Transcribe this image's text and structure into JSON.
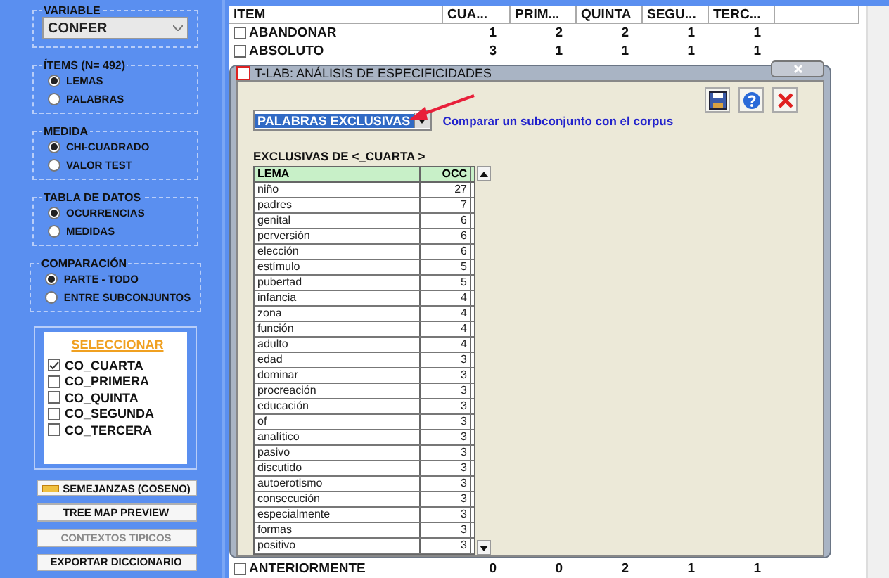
{
  "sidebar": {
    "variable": {
      "label": "VARIABLE",
      "value": "CONFER"
    },
    "groups": [
      {
        "title": "ÍTEMS (N= 492)",
        "options": [
          {
            "label": "LEMAS",
            "selected": true
          },
          {
            "label": "PALABRAS",
            "selected": false
          }
        ]
      },
      {
        "title": "MEDIDA",
        "options": [
          {
            "label": "CHI-CUADRADO",
            "selected": true
          },
          {
            "label": "VALOR TEST",
            "selected": false
          }
        ]
      },
      {
        "title": "TABLA DE DATOS",
        "options": [
          {
            "label": "OCURRENCIAS",
            "selected": true
          },
          {
            "label": "MEDIDAS",
            "selected": false
          }
        ]
      },
      {
        "title": "COMPARACIÓN",
        "options": [
          {
            "label": "PARTE - TODO",
            "selected": true
          },
          {
            "label": "ENTRE SUBCONJUNTOS",
            "selected": false
          }
        ]
      }
    ],
    "select_list": {
      "title": "SELECCIONAR",
      "items": [
        {
          "label": "CO_CUARTA",
          "checked": true
        },
        {
          "label": "CO_PRIMERA",
          "checked": false
        },
        {
          "label": "CO_QUINTA",
          "checked": false
        },
        {
          "label": "CO_SEGUNDA",
          "checked": false
        },
        {
          "label": "CO_TERCERA",
          "checked": false
        }
      ]
    },
    "buttons": [
      {
        "label": "SEMEJANZAS (COSENO)",
        "disabled": false,
        "kind": "icon"
      },
      {
        "label": "TREE MAP PREVIEW",
        "disabled": false,
        "kind": "plain"
      },
      {
        "label": "CONTEXTOS TIPICOS",
        "disabled": true,
        "kind": "plain"
      },
      {
        "label": "EXPORTAR DICCIONARIO",
        "disabled": false,
        "kind": "plain"
      }
    ]
  },
  "table": {
    "columns": [
      "ITEM",
      "CUA...",
      "PRIM...",
      "QUINTA",
      "SEGU...",
      "TERC..."
    ],
    "rows": [
      {
        "item": "ABANDONAR",
        "checked": false,
        "values": [
          "1",
          "2",
          "2",
          "1",
          "1"
        ]
      },
      {
        "item": "ABSOLUTO",
        "checked": false,
        "values": [
          "3",
          "1",
          "1",
          "1",
          "1"
        ]
      },
      {
        "item": "ANTERIORMENTE",
        "checked": false,
        "values": [
          "0",
          "0",
          "2",
          "1",
          "1"
        ]
      }
    ]
  },
  "dialog": {
    "title": "T-LAB: ANÁLISIS DE ESPECIFICIDADES",
    "mode": "PALABRAS EXCLUSIVAS",
    "description": "Comparar un subconjunto con el corpus",
    "subtitle": "EXCLUSIVAS DE <_CUARTA >",
    "columns": [
      "LEMA",
      "OCC"
    ],
    "rows": [
      {
        "lema": "niño",
        "occ": "27"
      },
      {
        "lema": "padres",
        "occ": "7"
      },
      {
        "lema": "genital",
        "occ": "6"
      },
      {
        "lema": "perversión",
        "occ": "6"
      },
      {
        "lema": "elección",
        "occ": "6"
      },
      {
        "lema": "estímulo",
        "occ": "5"
      },
      {
        "lema": "pubertad",
        "occ": "5"
      },
      {
        "lema": "infancia",
        "occ": "4"
      },
      {
        "lema": "zona",
        "occ": "4"
      },
      {
        "lema": "función",
        "occ": "4"
      },
      {
        "lema": "adulto",
        "occ": "4"
      },
      {
        "lema": "edad",
        "occ": "3"
      },
      {
        "lema": "dominar",
        "occ": "3"
      },
      {
        "lema": "procreación",
        "occ": "3"
      },
      {
        "lema": "educación",
        "occ": "3"
      },
      {
        "lema": "of",
        "occ": "3"
      },
      {
        "lema": "analítico",
        "occ": "3"
      },
      {
        "lema": "pasivo",
        "occ": "3"
      },
      {
        "lema": "discutido",
        "occ": "3"
      },
      {
        "lema": "autoerotismo",
        "occ": "3"
      },
      {
        "lema": "consecución",
        "occ": "3"
      },
      {
        "lema": "especialmente",
        "occ": "3"
      },
      {
        "lema": "formas",
        "occ": "3"
      },
      {
        "lema": "positivo",
        "occ": "3"
      }
    ]
  }
}
